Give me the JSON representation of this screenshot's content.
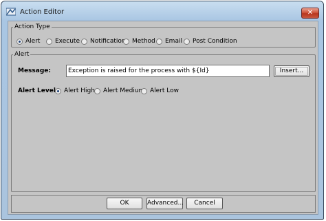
{
  "window": {
    "title": "Action Editor",
    "close_glyph": "✕"
  },
  "action_type": {
    "legend": "Action Type",
    "options": [
      "Alert",
      "Execute",
      "Notification",
      "Method",
      "Email",
      "Post Condition"
    ],
    "selected": "Alert"
  },
  "alert": {
    "legend": "Alert",
    "message_label": "Message:",
    "message_value": "Exception is raised for the process with  ${Id}",
    "insert_button": "Insert...",
    "level_label": "Alert Level:",
    "levels": [
      "Alert High",
      "Alert Medium",
      "Alert Low"
    ],
    "selected_level": "Alert High"
  },
  "buttons": {
    "ok": "OK",
    "advanced": "Advanced...",
    "cancel": "Cancel"
  },
  "icons": {
    "app": "action-editor-app-icon",
    "close": "close-icon",
    "radio": "radio-button-icon"
  },
  "colors": {
    "close_button": "#c7563e",
    "dialog_background": "#c5c5c5",
    "titlebar": "#a9c6e3"
  }
}
